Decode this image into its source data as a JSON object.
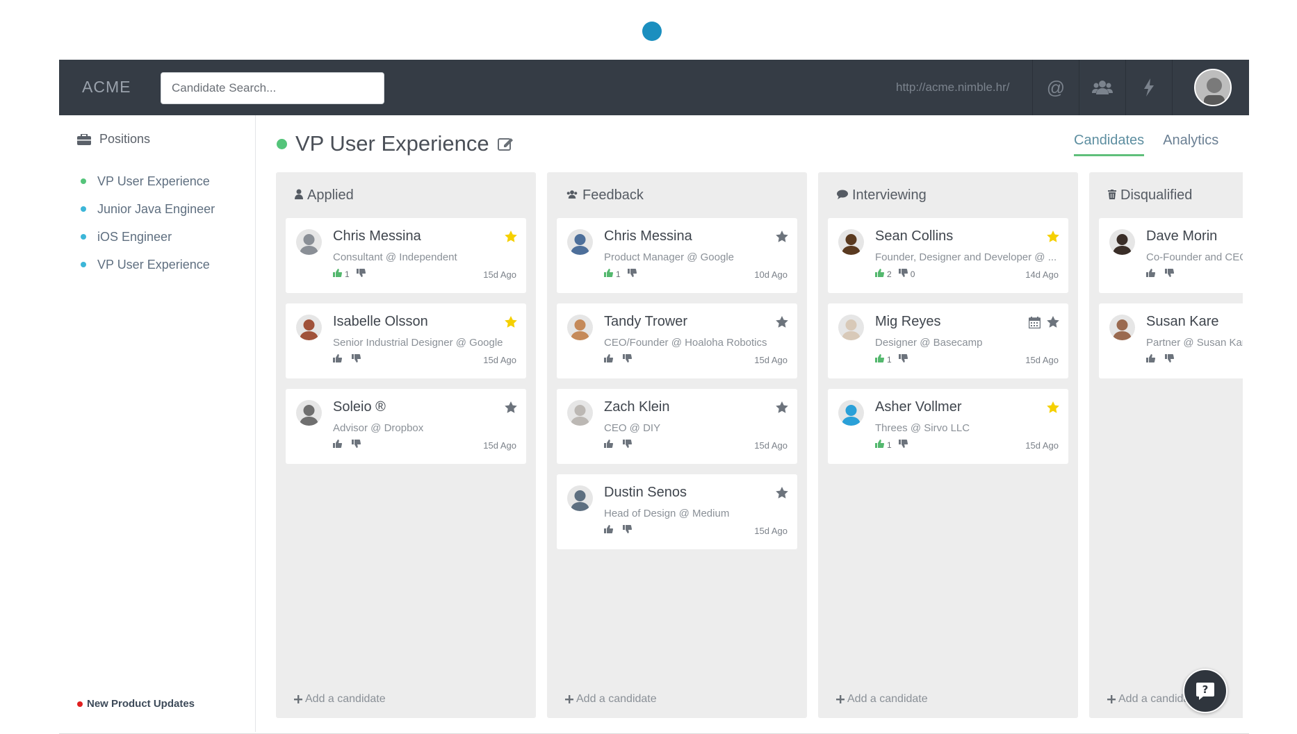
{
  "header": {
    "logo": "ACME",
    "search_placeholder": "Candidate Search...",
    "url": "http://acme.nimble.hr/",
    "icons": [
      "at-icon",
      "team-icon",
      "bolt-icon"
    ]
  },
  "sidebar": {
    "heading": "Positions",
    "items": [
      {
        "label": "VP User Experience",
        "color": "#54c47a"
      },
      {
        "label": "Junior Java Engineer",
        "color": "#3cb6d8"
      },
      {
        "label": "iOS Engineer",
        "color": "#3cb6d8"
      },
      {
        "label": "VP User Experience",
        "color": "#3cb6d8"
      }
    ],
    "updates": "New Product Updates"
  },
  "page": {
    "title": "VP User Experience",
    "tabs": [
      "Candidates",
      "Analytics"
    ],
    "active_tab": "Candidates"
  },
  "columns": [
    {
      "title": "Applied",
      "icon": "user-icon",
      "add_label": "Add a candidate",
      "cards": [
        {
          "name": "Chris Messina",
          "role": "Consultant @ Independent",
          "up": "1",
          "down": "",
          "ago": "15d Ago",
          "starred": true,
          "calendar": false,
          "avatar_color": "#8a8f96"
        },
        {
          "name": "Isabelle Olsson",
          "role": "Senior Industrial Designer @ Google",
          "up": "",
          "down": "",
          "ago": "15d Ago",
          "starred": true,
          "calendar": false,
          "avatar_color": "#a0523a"
        },
        {
          "name": "Soleio ®",
          "role": "Advisor @ Dropbox",
          "up": "",
          "down": "",
          "ago": "15d Ago",
          "starred": false,
          "calendar": false,
          "avatar_color": "#6f6f6f"
        }
      ]
    },
    {
      "title": "Feedback",
      "icon": "team-icon",
      "add_label": "Add a candidate",
      "cards": [
        {
          "name": "Chris Messina",
          "role": "Product Manager @ Google",
          "up": "1",
          "down": "",
          "ago": "10d Ago",
          "starred": false,
          "calendar": false,
          "avatar_color": "#4d6f9a"
        },
        {
          "name": "Tandy Trower",
          "role": "CEO/Founder @ Hoaloha Robotics",
          "up": "",
          "down": "",
          "ago": "15d Ago",
          "starred": false,
          "calendar": false,
          "avatar_color": "#c58a5a"
        },
        {
          "name": "Zach Klein",
          "role": "CEO @ DIY",
          "up": "",
          "down": "",
          "ago": "15d Ago",
          "starred": false,
          "calendar": false,
          "avatar_color": "#bcb8b4"
        },
        {
          "name": "Dustin Senos",
          "role": "Head of Design @ Medium",
          "up": "",
          "down": "",
          "ago": "15d Ago",
          "starred": false,
          "calendar": false,
          "avatar_color": "#5d6f80"
        }
      ]
    },
    {
      "title": "Interviewing",
      "icon": "comment-icon",
      "add_label": "Add a candidate",
      "cards": [
        {
          "name": "Sean Collins",
          "role": "Founder, Designer and Developer @ ...",
          "up": "2",
          "down": "0",
          "ago": "14d Ago",
          "starred": true,
          "calendar": false,
          "avatar_color": "#5a3a20"
        },
        {
          "name": "Mig Reyes",
          "role": "Designer @ Basecamp",
          "up": "1",
          "down": "",
          "ago": "15d Ago",
          "starred": false,
          "calendar": true,
          "avatar_color": "#d8c9b8"
        },
        {
          "name": "Asher Vollmer",
          "role": "Threes @ Sirvo LLC",
          "up": "1",
          "down": "",
          "ago": "15d Ago",
          "starred": true,
          "calendar": false,
          "avatar_color": "#2aa0d8"
        }
      ]
    },
    {
      "title": "Disqualified",
      "icon": "trash-icon",
      "add_label": "Add a candidate",
      "cards": [
        {
          "name": "Dave Morin",
          "role": "Co-Founder and CEO",
          "up": "",
          "down": "",
          "ago": "",
          "starred": false,
          "calendar": false,
          "avatar_color": "#3a2e28"
        },
        {
          "name": "Susan Kare",
          "role": "Partner @ Susan Kare",
          "up": "",
          "down": "",
          "ago": "",
          "starred": false,
          "calendar": false,
          "avatar_color": "#9a6a50"
        }
      ]
    }
  ],
  "colors": {
    "header_bg": "#353c45",
    "column_bg": "#ededed",
    "star_active": "#f5d000",
    "star_inactive": "#6c737c",
    "thumbs_up_active": "#54b86e",
    "accent_green": "#54c47a"
  }
}
